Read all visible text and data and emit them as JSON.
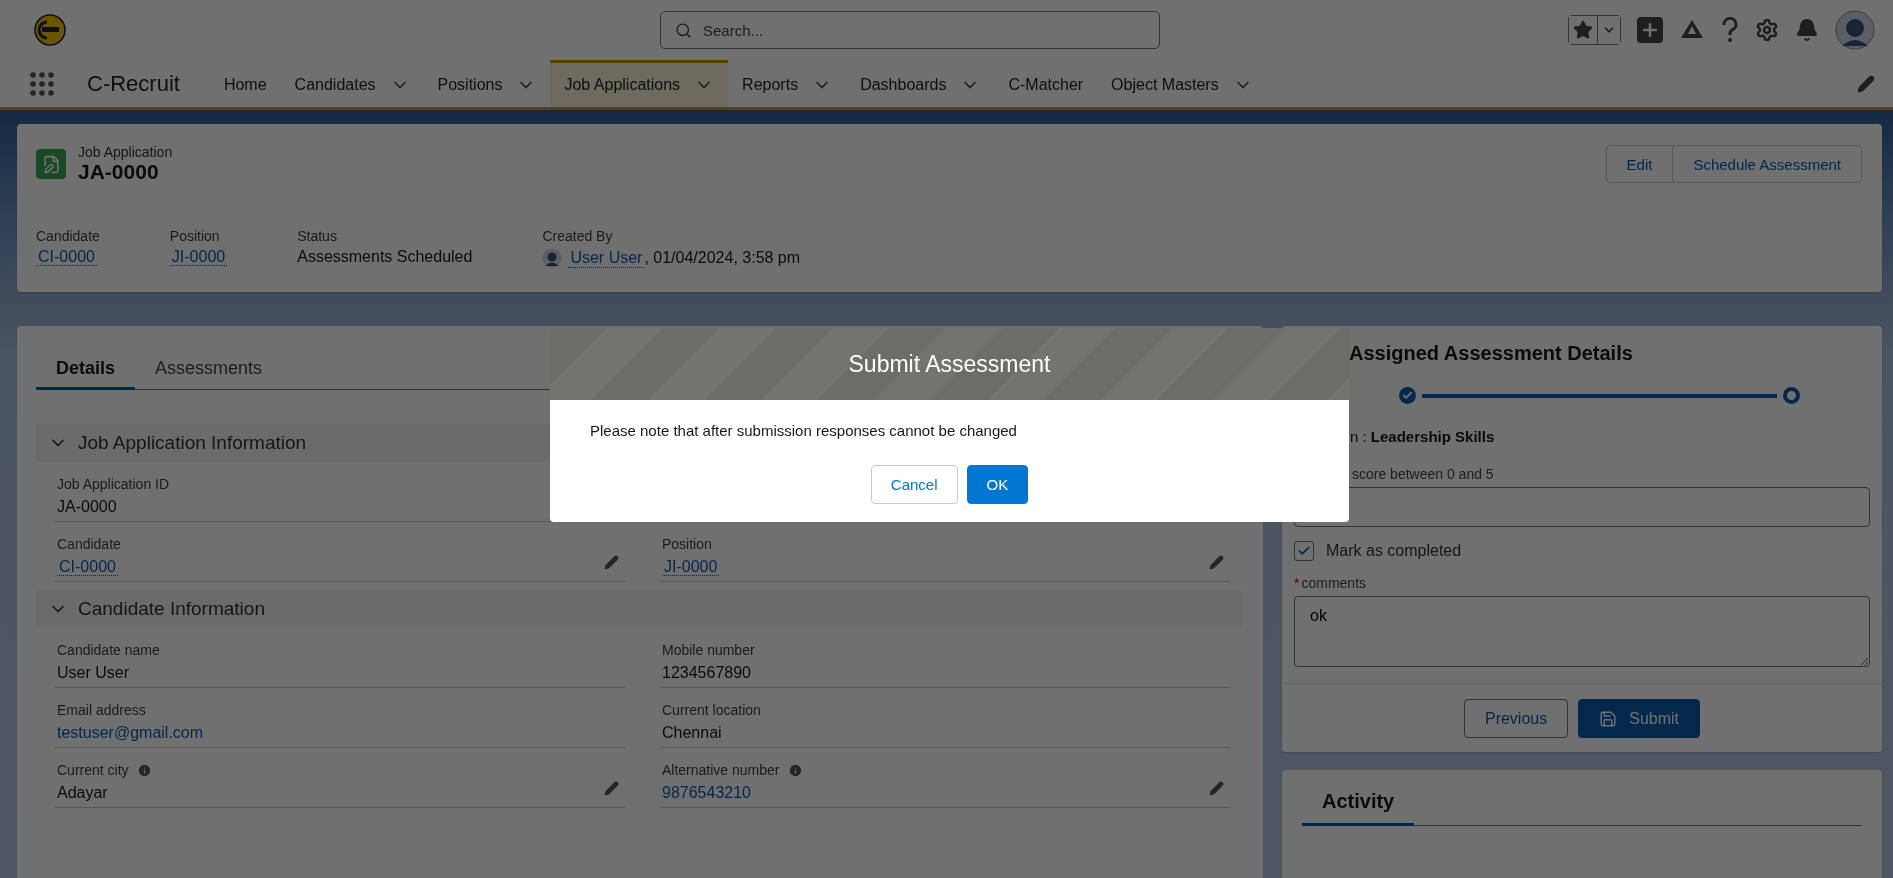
{
  "global_header": {
    "search": {
      "placeholder": "Search..."
    }
  },
  "nav": {
    "app_name": "C-Recruit",
    "items": [
      {
        "label": "Home",
        "has_menu": false,
        "selected": false
      },
      {
        "label": "Candidates",
        "has_menu": true,
        "selected": false
      },
      {
        "label": "Positions",
        "has_menu": true,
        "selected": false
      },
      {
        "label": "Job Applications",
        "has_menu": true,
        "selected": true
      },
      {
        "label": "Reports",
        "has_menu": true,
        "selected": false
      },
      {
        "label": "Dashboards",
        "has_menu": true,
        "selected": false
      },
      {
        "label": "C-Matcher",
        "has_menu": false,
        "selected": false
      },
      {
        "label": "Object Masters",
        "has_menu": true,
        "selected": false
      }
    ]
  },
  "record": {
    "object": "Job Application",
    "name": "JA-0000",
    "actions": [
      "Edit",
      "Schedule Assessment"
    ],
    "highlights": [
      {
        "label": "Candidate",
        "value": "CI-0000",
        "kind": "lookup"
      },
      {
        "label": "Position",
        "value": "JI-0000",
        "kind": "lookup"
      },
      {
        "label": "Status",
        "value": "Assessments Scheduled",
        "kind": "text"
      },
      {
        "label": "Created By",
        "value": "User User",
        "kind": "user",
        "suffix": ", 01/04/2024, 3:58 pm"
      }
    ]
  },
  "tabs": [
    {
      "label": "Details",
      "selected": true
    },
    {
      "label": "Assessments",
      "selected": false
    }
  ],
  "sections": [
    {
      "title": "Job Application Information",
      "expanded": true,
      "rows": [
        [
          {
            "label": "Job Application ID",
            "value": "JA-0000",
            "kind": "text",
            "editable": false,
            "info": false
          }
        ],
        [
          {
            "label": "Candidate",
            "value": "CI-0000",
            "kind": "lookup",
            "editable": true,
            "info": false
          },
          {
            "label": "Position",
            "value": "JI-0000",
            "kind": "lookup",
            "editable": true,
            "info": false
          }
        ]
      ]
    },
    {
      "title": "Candidate Information",
      "expanded": true,
      "rows": [
        [
          {
            "label": "Candidate name",
            "value": "User User",
            "kind": "text",
            "editable": false,
            "info": false
          },
          {
            "label": "Mobile number",
            "value": "1234567890",
            "kind": "text",
            "editable": false,
            "info": false
          }
        ],
        [
          {
            "label": "Email address",
            "value": "testuser@gmail.com",
            "kind": "link",
            "editable": false,
            "info": false
          },
          {
            "label": "Current location",
            "value": "Chennai",
            "kind": "text",
            "editable": false,
            "info": false
          }
        ],
        [
          {
            "label": "Current city",
            "value": "Adayar",
            "kind": "text",
            "editable": true,
            "info": true
          },
          {
            "label": "Alternative number",
            "value": "9876543210",
            "kind": "link",
            "editable": true,
            "info": true
          }
        ]
      ]
    }
  ],
  "assessment": {
    "title": "Assigned Assessment Details",
    "steps": [
      {
        "complete": true,
        "current": false
      },
      {
        "complete": false,
        "current": true
      }
    ],
    "question": "n : **Leadership Skills**",
    "score_label": "score between 0 and 5",
    "completed": {
      "label": "Mark as completed",
      "checked": true
    },
    "comments": {
      "label": "comments",
      "required_mark": "*",
      "value": "ok"
    },
    "buttons": [
      {
        "label": "Previous",
        "kind": "secondary"
      },
      {
        "label": "Submit",
        "kind": "primary"
      }
    ]
  },
  "activity": {
    "tabs": [
      {
        "label": "Activity",
        "selected": true
      }
    ]
  },
  "modal": {
    "title": "Submit Assessment",
    "message": "Please note that after submission responses cannot be changed",
    "buttons": [
      {
        "label": "Cancel",
        "kind": "secondary"
      },
      {
        "label": "OK",
        "kind": "primary"
      }
    ]
  }
}
